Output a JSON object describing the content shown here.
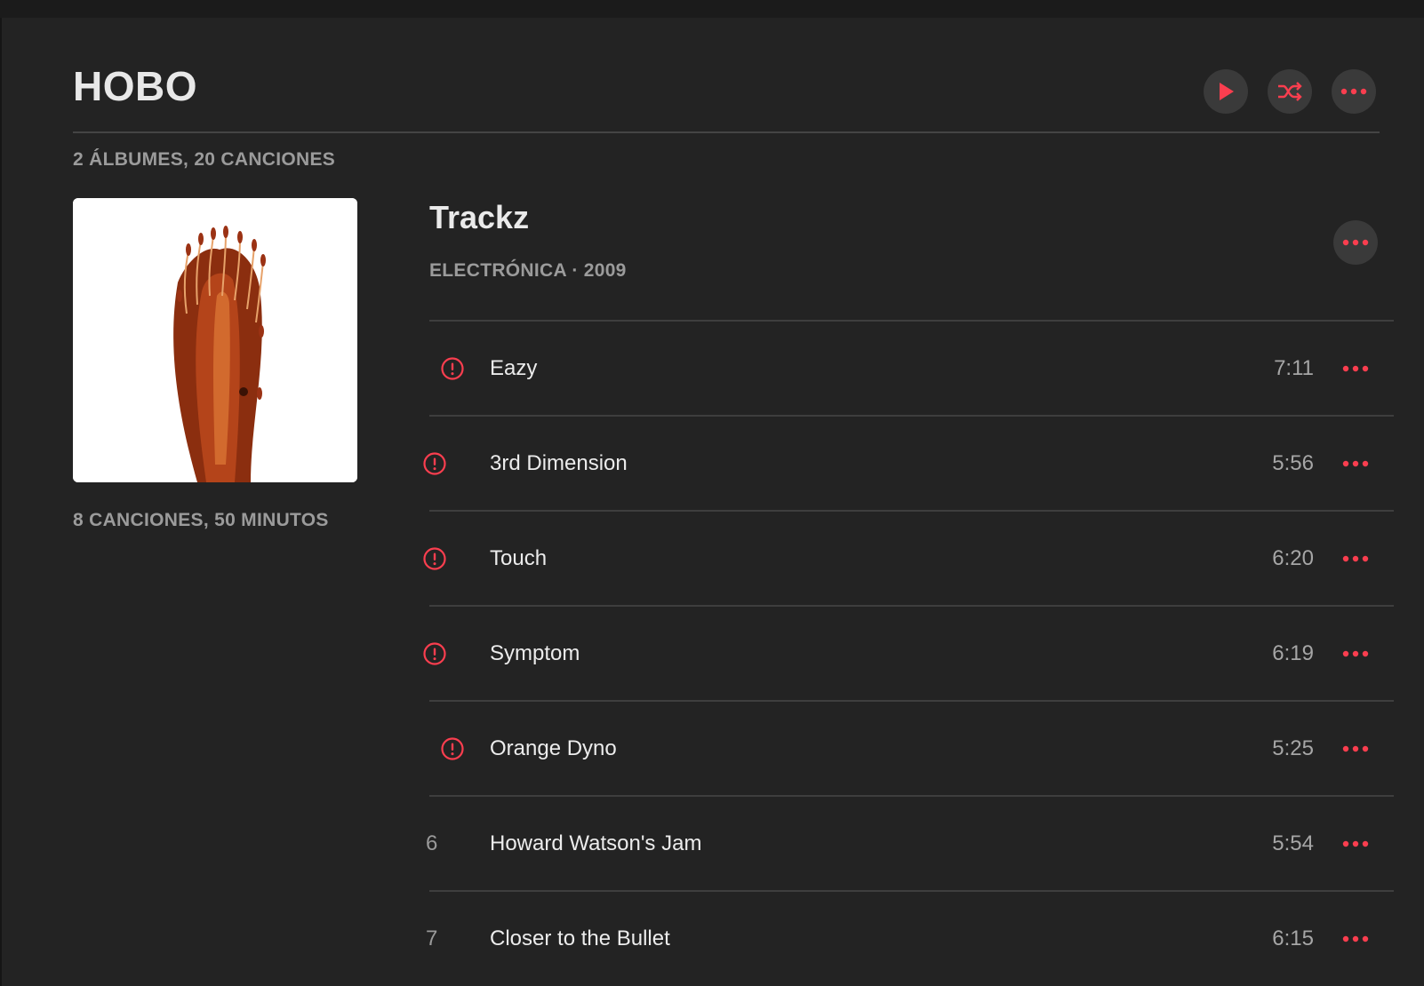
{
  "artist": {
    "name": "HOBO",
    "meta": "2 ÁLBUMES, 20 CANCIONES"
  },
  "colors": {
    "accent": "#fa3e4f",
    "background": "#232323",
    "button_bg": "#3a3a3a"
  },
  "header_actions": [
    {
      "icon": "play-icon"
    },
    {
      "icon": "shuffle-icon"
    },
    {
      "icon": "more-icon"
    }
  ],
  "album": {
    "title": "Trackz",
    "subtitle": "ELECTRÓNICA · 2009",
    "summary": "8 CANCIONES, 50 MINUTOS",
    "artwork_icon": "album-artwork"
  },
  "tracks": [
    {
      "lead": "",
      "status_icon": "alert-circle-icon",
      "title": "Eazy",
      "duration": "7:11"
    },
    {
      "lead": "",
      "status_icon": "alert-circle-icon",
      "title": "3rd Dimension",
      "duration": "5:56"
    },
    {
      "lead": "",
      "status_icon": "alert-circle-icon",
      "title": "Touch",
      "duration": "6:20"
    },
    {
      "lead": "",
      "status_icon": "alert-circle-icon",
      "title": "Symptom",
      "duration": "6:19"
    },
    {
      "lead": "",
      "status_icon": "alert-circle-icon",
      "title": "Orange Dyno",
      "duration": "5:25"
    },
    {
      "lead": "6",
      "status_icon": "",
      "title": "Howard Watson's Jam",
      "duration": "5:54"
    },
    {
      "lead": "7",
      "status_icon": "",
      "title": "Closer to the Bullet",
      "duration": "6:15"
    }
  ]
}
